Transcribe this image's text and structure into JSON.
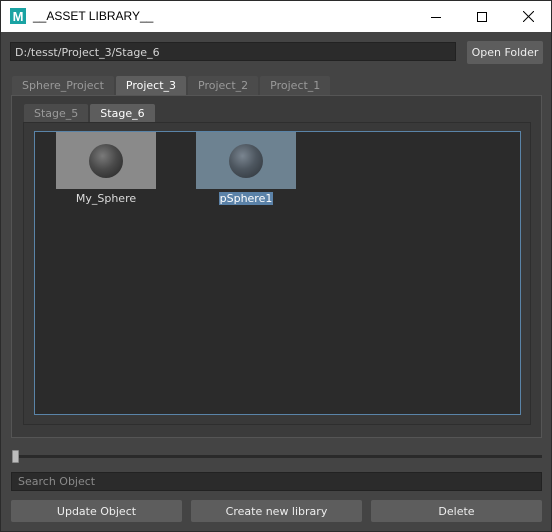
{
  "window": {
    "title": "__ASSET LIBRARY__",
    "app_icon_letter": "M"
  },
  "path": {
    "value": "D:/tesst/Project_3/Stage_6"
  },
  "buttons": {
    "open_folder": "Open Folder",
    "update_object": "Update Object",
    "create_new_library": "Create new library",
    "delete": "Delete"
  },
  "project_tabs": [
    {
      "label": "Sphere_Project",
      "active": false
    },
    {
      "label": "Project_3",
      "active": true
    },
    {
      "label": "Project_2",
      "active": false
    },
    {
      "label": "Project_1",
      "active": false
    }
  ],
  "stage_tabs": [
    {
      "label": "Stage_5",
      "active": false
    },
    {
      "label": "Stage_6",
      "active": true
    }
  ],
  "assets": [
    {
      "label": "My_Sphere",
      "selected": false
    },
    {
      "label": "pSphere1",
      "selected": true
    }
  ],
  "slider": {
    "value": 0
  },
  "search": {
    "placeholder": "Search Object",
    "value": ""
  },
  "colors": {
    "background": "#444444",
    "selection": "#5b82a8",
    "viewport_border": "#5a84a8",
    "icon_teal": "#1aa3a3"
  }
}
